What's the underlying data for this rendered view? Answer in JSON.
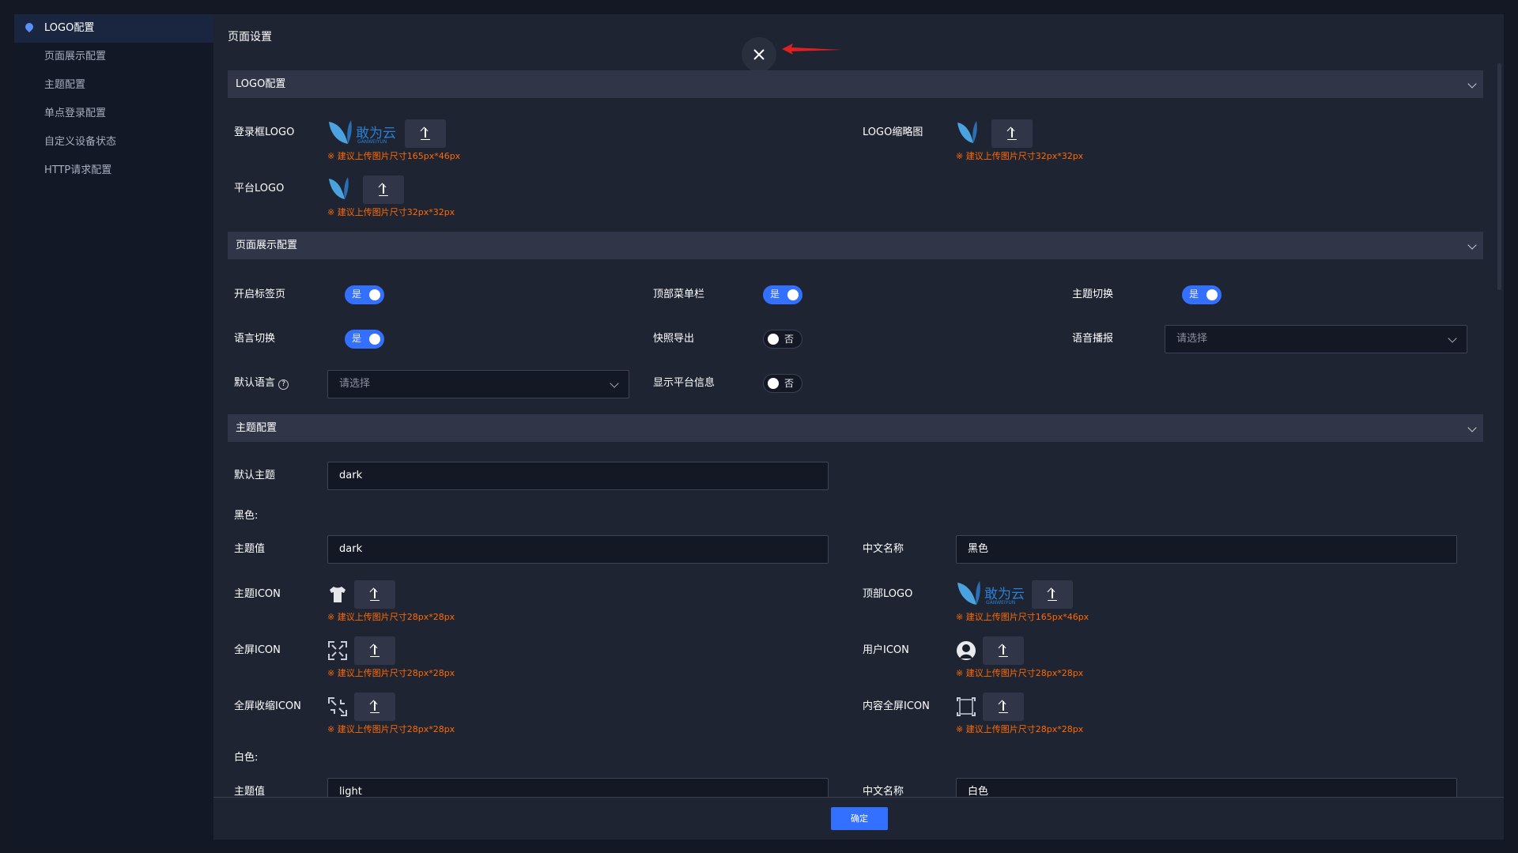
{
  "sidebar": {
    "items": [
      "LOGO配置",
      "页面展示配置",
      "主题配置",
      "单点登录配置",
      "自定义设备状态",
      "HTTP请求配置"
    ]
  },
  "page_title": "页面设置",
  "logo_section": {
    "title": "LOGO配置",
    "login_logo": "登录框LOGO",
    "login_hint": "※ 建议上传图片尺寸165px*46px",
    "thumb": "LOGO缩略图",
    "thumb_hint": "※ 建议上传图片尺寸32px*32px",
    "platform": "平台LOGO",
    "platform_hint": "※ 建议上传图片尺寸32px*32px",
    "brand_text": "敢为云",
    "brand_sub": "GANWEIYUN"
  },
  "display_section": {
    "title": "页面展示配置",
    "tabs": "开启标签页",
    "top_menu": "顶部菜单栏",
    "theme_switch": "主题切换",
    "lang_switch": "语言切换",
    "snapshot": "快照导出",
    "voice": "语音播报",
    "default_lang": "默认语言",
    "platform_info": "显示平台信息",
    "yes": "是",
    "no": "否",
    "placeholder": "请选择",
    "help": "?"
  },
  "theme_section": {
    "title": "主题配置",
    "default_theme": "默认主题",
    "default_theme_value": "dark",
    "black": "黑色:",
    "theme_value": "主题值",
    "black_value": "dark",
    "cn_name": "中文名称",
    "black_cn": "黑色",
    "theme_icon": "主题ICON",
    "top_logo": "顶部LOGO",
    "fullscreen_icon": "全屏ICON",
    "user_icon": "用户ICON",
    "exit_fs_icon": "全屏收缩ICON",
    "content_fs_icon": "内容全屏ICON",
    "hint28": "※ 建议上传图片尺寸28px*28px",
    "hint165": "※ 建议上传图片尺寸165px*46px",
    "white": "白色:",
    "white_value": "light",
    "white_cn": "白色"
  },
  "footer": {
    "confirm": "确定"
  },
  "colors": {
    "accent": "#3370ff",
    "hint": "#ff6a00",
    "arrow": "#e02020"
  }
}
